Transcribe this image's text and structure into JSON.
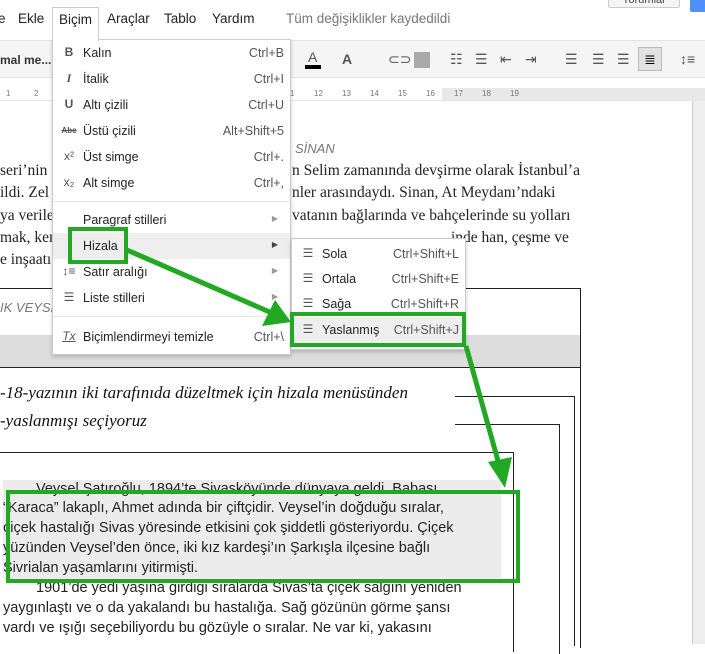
{
  "menubar": {
    "items": [
      "e",
      "Ekle",
      "Biçim",
      "Araçlar",
      "Tablo",
      "Yardım"
    ],
    "status": "Tüm değişiklikler kaydedildi",
    "comments_label": "Yorumlar"
  },
  "toolbar": {
    "style_select": "mal me...",
    "font_color_label": "A",
    "highlight_label": "A"
  },
  "ruler": {
    "ticks": [
      "1",
      "2",
      "9",
      "10",
      "11",
      "12",
      "13",
      "14",
      "15",
      "16",
      "17",
      "18",
      "19"
    ]
  },
  "format_menu": {
    "items": [
      {
        "icon": "B",
        "label": "Kalın",
        "shortcut": "Ctrl+B"
      },
      {
        "icon": "I",
        "label": "İtalik",
        "shortcut": "Ctrl+I"
      },
      {
        "icon": "U",
        "label": "Altı çizili",
        "shortcut": "Ctrl+U"
      },
      {
        "icon": "Abc",
        "label": "Üstü çizili",
        "shortcut": "Alt+Shift+5"
      },
      {
        "icon": "x²",
        "label": "Üst simge",
        "shortcut": "Ctrl+."
      },
      {
        "icon": "x₂",
        "label": "Alt simge",
        "shortcut": "Ctrl+,"
      },
      {
        "label": "Paragraf stilleri"
      },
      {
        "label": "Hizala"
      },
      {
        "icon": "↕≡",
        "label": "Satır aralığı"
      },
      {
        "icon": "☰",
        "label": "Liste stilleri"
      },
      {
        "icon": "Tx",
        "label": "Biçimlendirmeyi temizle",
        "shortcut": "Ctrl+\\"
      }
    ]
  },
  "align_submenu": {
    "items": [
      {
        "label": "Sola",
        "shortcut": "Ctrl+Shift+L"
      },
      {
        "label": "Ortala",
        "shortcut": "Ctrl+Shift+E"
      },
      {
        "label": "Sağa",
        "shortcut": "Ctrl+Shift+R"
      },
      {
        "label": "Yaslanmış",
        "shortcut": "Ctrl+Shift+J"
      }
    ]
  },
  "document": {
    "heading": "SİNAN",
    "lines_left": [
      "seri’nin",
      "ildi. Zel",
      "ya verile",
      "mak, ker",
      "e inşaatı"
    ],
    "lines_right": [
      "n Selim zamanında devşirme olarak İstanbul’a",
      "nler arasındaydı. Sinan, At Meydanı’ndaki",
      "vatanın bağlarında ve bahçelerinde su yolları",
      "inde han, çeşme ve"
    ],
    "table_header": "IK VEYSE",
    "note_lines": [
      "-18-yazının iki tarafınıda düzeltmek için hizala menüsünden",
      "-yaslanmışı seçiyoruz"
    ],
    "paragraph1": [
      "Veysel Şatıroğlu, 1894’te Sivasköyünde dünyaya geldi. Babası",
      "“Karaca” lakaplı, Ahmet adında bir çiftçidir. Veysel’in doğduğu sıralar,",
      "çiçek hastalığı Sivas yöresinde etkisini çok şiddetli gösteriyordu. Çiçek",
      "yüzünden Veysel’den önce, iki kız kardeşi’ın Şarkışla ilçesine bağlı",
      "Sivrialan yaşamlarını yitirmişti."
    ],
    "paragraph2": [
      "1901’de yedi yaşına girdiği sıralarda Sivas’ta çiçek salgını yeniden",
      "yaygınlaştı ve o da yakalandı bu hastalığa. Sağ gözünün görme şansı",
      "vardı ve ışığı seçebiliyordu bu gözüyle o sıralar. Ne var ki, yakasını"
    ]
  },
  "colors": {
    "annotation": "#22a822",
    "accent": "#4d90fe"
  }
}
